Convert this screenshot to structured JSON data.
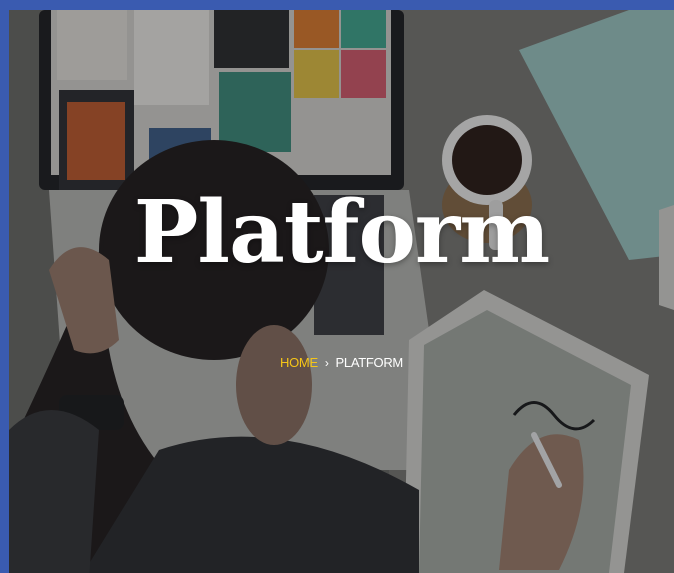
{
  "hero": {
    "title": "Platform"
  },
  "breadcrumb": {
    "home": "HOME",
    "separator": "›",
    "current": "PLATFORM"
  },
  "colors": {
    "frame": "#3a5bb0",
    "breadcrumb_home": "#f5c518",
    "title": "#ffffff"
  }
}
